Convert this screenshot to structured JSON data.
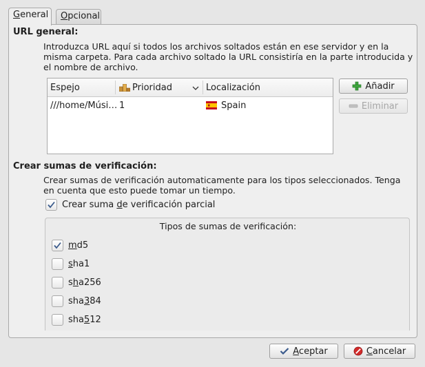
{
  "tabs": [
    {
      "label": "General",
      "active": true
    },
    {
      "label": "Opcional",
      "active": false
    }
  ],
  "url_section": {
    "title": "URL general:",
    "description_line1": "Introduzca URL aquí si todos los archivos soltados están en ese servidor y en la",
    "description_line2": "misma carpeta. Para cada archivo soltado la URL consistiría en la parte introducida y",
    "description_line3": "el nombre de archivo.",
    "columns": {
      "mirror": "Espejo",
      "priority": "Prioridad",
      "location": "Localización"
    },
    "rows": [
      {
        "mirror": "///home/Músi…",
        "priority": "1",
        "location": "Spain"
      }
    ],
    "add_button": "Añadir",
    "remove_button": "Eliminar"
  },
  "checksum_section": {
    "title": "Crear sumas de verificación:",
    "description_line1": "Crear sumas de verificación automaticamente para los tipos seleccionados. Tenga",
    "description_line2": "en cuenta que esto puede tomar un tiempo.",
    "partial_checkbox_pre": "Crear suma ",
    "partial_checkbox_ul": "d",
    "partial_checkbox_post": "e verificación parcial",
    "partial_checked": true,
    "types_title": "Tipos de sumas de verificación:",
    "types": [
      {
        "label": "md5",
        "checked": true
      },
      {
        "label": "sha1",
        "checked": false
      },
      {
        "label": "sha256",
        "checked": false
      },
      {
        "label": "sha384",
        "checked": false
      },
      {
        "label": "sha512",
        "checked": false
      }
    ]
  },
  "footer": {
    "accept": "Aceptar",
    "cancel": "Cancelar"
  },
  "colors": {
    "accent_check": "#3a5a8c",
    "spain_red": "#c60b1e",
    "spain_yellow": "#ffc400"
  }
}
